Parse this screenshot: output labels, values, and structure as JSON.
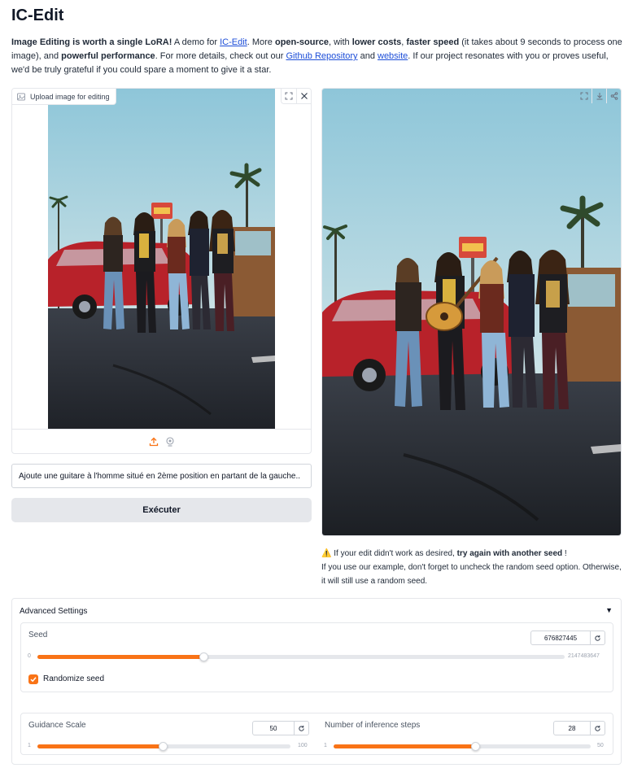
{
  "app": {
    "title": "IC-Edit"
  },
  "intro": {
    "bold1": "Image Editing is worth a single LoRA!",
    "t1": " A demo for ",
    "link1": "IC-Edit",
    "t2": ". More ",
    "bold2": "open-source",
    "t3": ", with ",
    "bold3": "lower costs",
    "t4": ", ",
    "bold4": "faster speed",
    "t5": " (it takes about 9 seconds to process one image), and ",
    "bold5": "powerful performance",
    "t6": ". For more details, check out our ",
    "link2": "Github Repository",
    "t7": " and ",
    "link3": "website",
    "t8": ". If our project resonates with you or proves useful, we'd be truly grateful if you could spare a moment to give it a star."
  },
  "input": {
    "label": "Upload image for editing",
    "icons": [
      "image-icon",
      "fullscreen-icon",
      "close-icon",
      "upload-icon",
      "webcam-icon"
    ]
  },
  "prompt": {
    "value": "Ajoute une guitare à l'homme situé en 2ème position en partant de la gauche.."
  },
  "run_button": {
    "label": "Exécuter"
  },
  "output": {
    "icons": [
      "fullscreen-icon",
      "download-icon",
      "share-icon"
    ]
  },
  "note": {
    "warn_icon": "⚠️",
    "t1": " If your edit didn't work as desired, ",
    "bold": "try again with another seed",
    "t2": " !",
    "line2": "If you use our example, don't forget to uncheck the random seed option. Otherwise, it will still use a random seed."
  },
  "advanced": {
    "title": "Advanced Settings",
    "caret": "▼",
    "seed": {
      "label": "Seed",
      "value": "676827445",
      "min": "0",
      "max": "2147483647",
      "fraction": 0.3152
    },
    "randomize": {
      "label": "Randomize seed",
      "checked": true
    },
    "guidance": {
      "label": "Guidance Scale",
      "value": "50",
      "min": "1",
      "max": "100",
      "fraction": 0.495
    },
    "steps": {
      "label": "Number of inference steps",
      "value": "28",
      "min": "1",
      "max": "50",
      "fraction": 0.551
    }
  },
  "colors": {
    "accent": "#f97316",
    "link": "#1d4ed8",
    "button_bg": "#e5e7eb"
  }
}
